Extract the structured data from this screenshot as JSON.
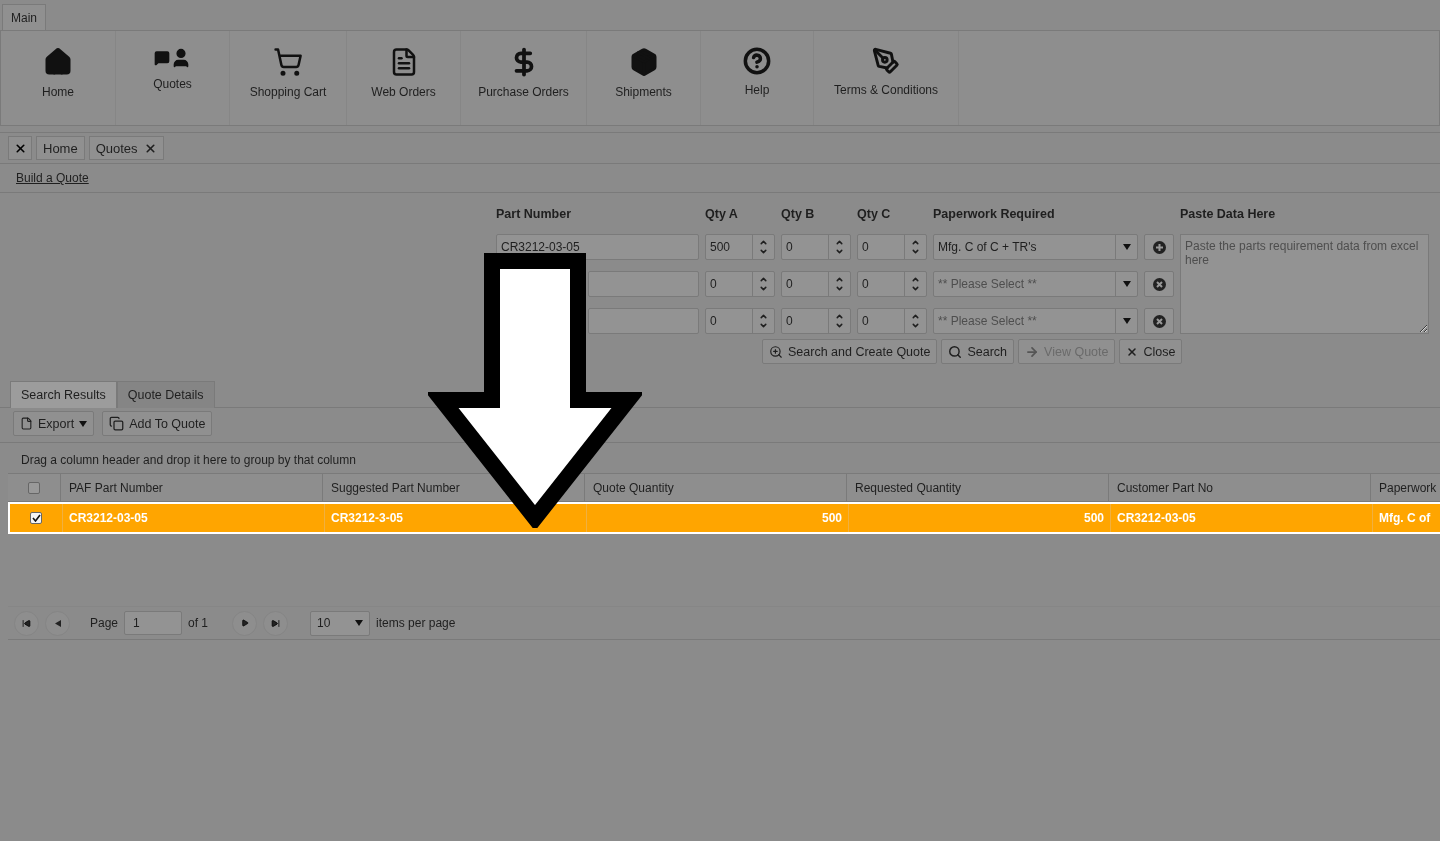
{
  "ribbon": {
    "tab": "Main",
    "items": [
      {
        "label": "Home",
        "kind": "home"
      },
      {
        "label": "Quotes",
        "kind": "quotes"
      },
      {
        "label": "Shopping Cart",
        "kind": "cart"
      },
      {
        "label": "Web Orders",
        "kind": "web"
      },
      {
        "label": "Purchase Orders",
        "kind": "purchase"
      },
      {
        "label": "Shipments",
        "kind": "shipments"
      },
      {
        "label": "Help",
        "kind": "help"
      },
      {
        "label": "Terms & Conditions",
        "kind": "terms"
      }
    ]
  },
  "doc_tabs": [
    {
      "label": "Home",
      "closable": false
    },
    {
      "label": "Quotes",
      "closable": true
    }
  ],
  "page_link": "Build a Quote",
  "form": {
    "labels": {
      "part": "Part Number",
      "qty_a": "Qty A",
      "qty_b": "Qty B",
      "qty_c": "Qty C",
      "paperwork": "Paperwork Required",
      "paste": "Paste Data Here"
    },
    "rows": [
      {
        "part": "CR3212-03-05",
        "qty_a": "500",
        "qty_b": "0",
        "qty_c": "0",
        "paperwork": "Mfg. C of C + TR's",
        "kind": "add"
      },
      {
        "qty_a": "0",
        "qty_b": "0",
        "qty_c": "0",
        "paperwork_placeholder": "** Please Select **",
        "kind": "remove"
      },
      {
        "qty_a": "0",
        "qty_b": "0",
        "qty_c": "0",
        "paperwork_placeholder": "** Please Select **",
        "kind": "remove"
      }
    ],
    "paste_placeholder": "Paste the parts requirement data from excel here",
    "buttons": [
      {
        "label": "Search and Create Quote",
        "kind": "search-create",
        "disabled": false
      },
      {
        "label": "Search",
        "kind": "search",
        "disabled": false
      },
      {
        "label": "View Quote",
        "kind": "view",
        "disabled": true
      },
      {
        "label": "Close",
        "kind": "close",
        "disabled": false
      }
    ]
  },
  "result_tabs": [
    {
      "label": "Search Results",
      "selected": true
    },
    {
      "label": "Quote Details",
      "selected": false
    }
  ],
  "toolbar": [
    {
      "label": "Export",
      "kind": "export"
    },
    {
      "label": "Add To Quote",
      "kind": "add"
    }
  ],
  "group_hint": "Drag a column header and drop it here to group by that column",
  "grid": {
    "all_checked": false,
    "columns": [
      {
        "label": "PAF Part Number",
        "kind": "text"
      },
      {
        "label": "Suggested Part Number",
        "kind": "text"
      },
      {
        "label": "Quote Quantity",
        "kind": "number"
      },
      {
        "label": "Requested Quantity",
        "kind": "number"
      },
      {
        "label": "Customer Part No",
        "kind": "text"
      },
      {
        "label": "Paperwork",
        "kind": "text"
      }
    ],
    "rows": [
      {
        "checked": true,
        "selected": true,
        "cells": [
          "CR3212-03-05",
          "CR3212-3-05",
          "500",
          "500",
          "CR3212-03-05",
          "Mfg. C of"
        ]
      }
    ]
  },
  "pager": {
    "page_label": "Page",
    "page": "1",
    "of": "of 1",
    "per_page": "10",
    "per_page_label": "items per page"
  },
  "annotation": {
    "kind": "down-arrow"
  }
}
